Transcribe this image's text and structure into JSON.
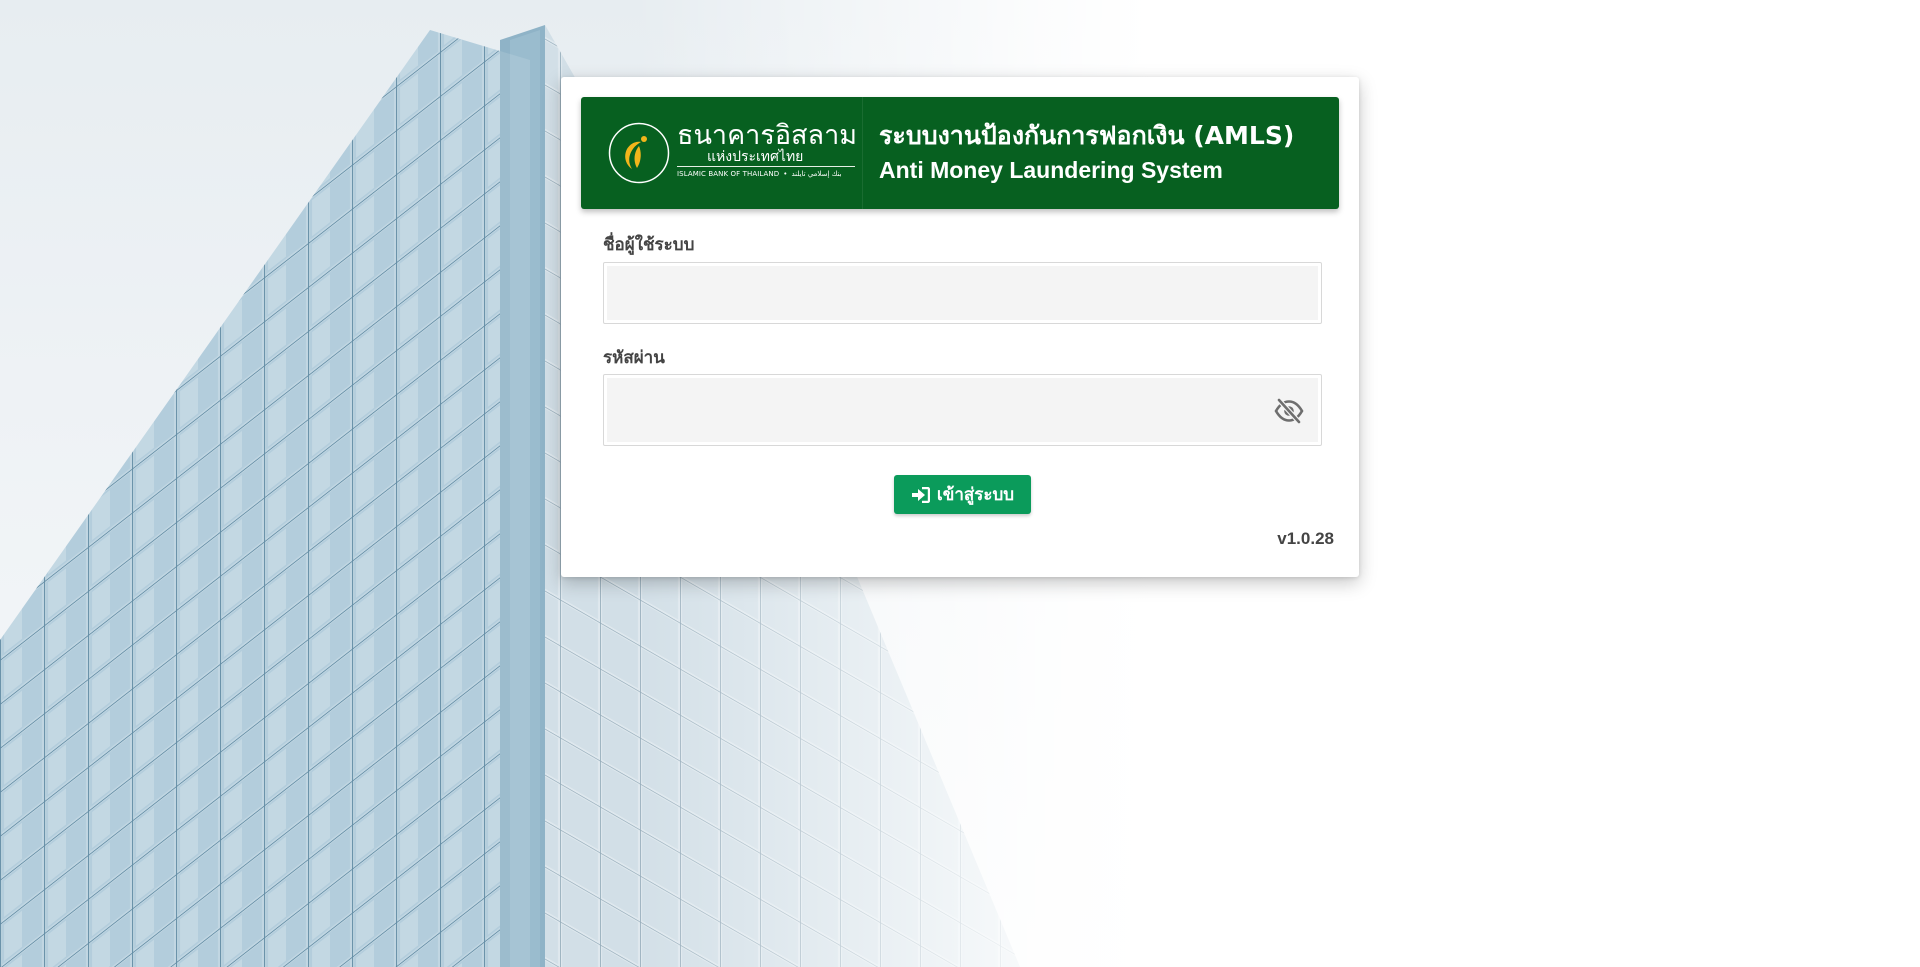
{
  "brand": {
    "name_th": "ธนาคารอิสลาม",
    "sub_th": "แห่งประเทศไทย",
    "name_en": "ISLAMIC BANK OF THAILAND",
    "name_jawi": "ﺑﻨﻚ إﺳﻼﻣﻲ ﺗﺎﻳﻠﻨﺪ",
    "logo_icon": "islamic-bank-crescent-logo"
  },
  "system": {
    "title_th": "ระบบงานป้องกันการฟอกเงิน (AMLS)",
    "title_en": "Anti Money Laundering System"
  },
  "form": {
    "username_label": "ชื่อผู้ใช้ระบบ",
    "username_value": "",
    "password_label": "รหัสผ่าน",
    "password_value": "",
    "password_toggle_icon": "eye-slash-icon",
    "login_icon": "sign-in-icon",
    "login_label": "เข้าสู่ระบบ"
  },
  "version": "v1.0.28",
  "colors": {
    "banner": "#076020",
    "button": "#0b9b5b",
    "logo_gold": "#f2b51b"
  }
}
